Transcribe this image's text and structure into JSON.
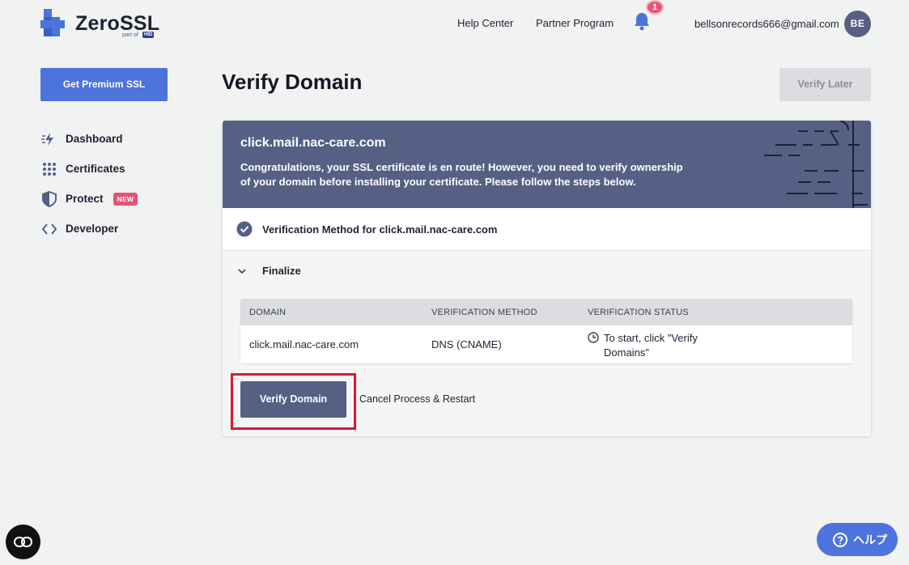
{
  "brand": {
    "name": "ZeroSSL",
    "sub": "part of",
    "parent": "HID"
  },
  "topnav": {
    "help_center": "Help Center",
    "partner_program": "Partner Program",
    "notification_count": "1",
    "user_email": "bellsonrecords666@gmail.com",
    "user_initials": "BE"
  },
  "sidebar": {
    "premium_button": "Get Premium SSL",
    "items": [
      {
        "label": "Dashboard",
        "icon": "lightning-icon"
      },
      {
        "label": "Certificates",
        "icon": "grid-dots-icon"
      },
      {
        "label": "Protect",
        "icon": "shield-icon",
        "badge": "NEW"
      },
      {
        "label": "Developer",
        "icon": "code-icon"
      }
    ]
  },
  "main": {
    "title": "Verify Domain",
    "verify_later": "Verify Later",
    "hero": {
      "domain": "click.mail.nac-care.com",
      "message": "Congratulations, your SSL certificate is en route! However, you need to verify ownership of your domain before installing your certificate. Please follow the steps below."
    },
    "step1": "Verification Method for click.mail.nac-care.com",
    "step2": "Finalize",
    "table": {
      "headers": [
        "DOMAIN",
        "VERIFICATION METHOD",
        "VERIFICATION STATUS"
      ],
      "row": {
        "domain": "click.mail.nac-care.com",
        "method": "DNS (CNAME)",
        "status": "To start, click \"Verify Domains\""
      }
    },
    "verify_button": "Verify Domain",
    "cancel_link": "Cancel Process & Restart"
  },
  "help_widget": "ヘルプ",
  "colors": {
    "accent": "#4d73dc",
    "hero": "#566085",
    "badge": "#e25575",
    "highlight": "#e0162b"
  }
}
